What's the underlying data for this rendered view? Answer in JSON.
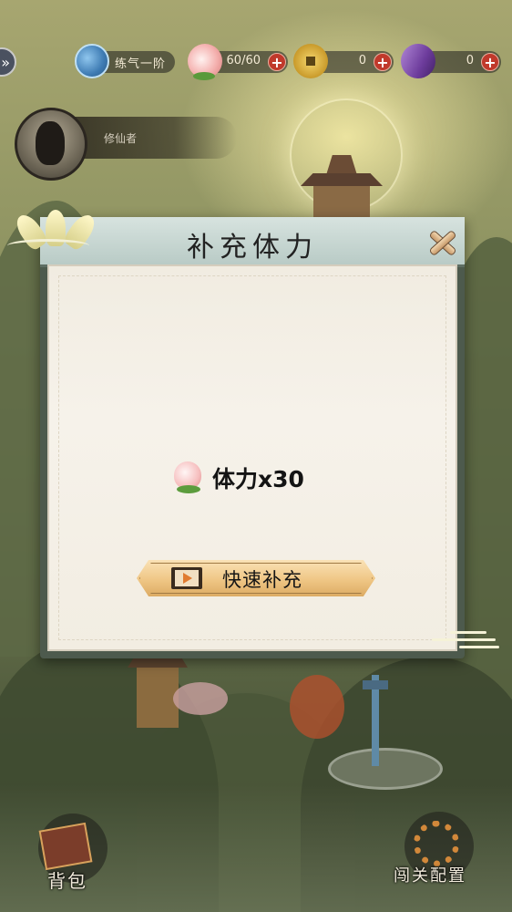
{
  "top_bar": {
    "realm": {
      "icon": "taiji-icon",
      "label": "练气一阶"
    },
    "stamina": {
      "icon": "peach-icon",
      "value": "60/60"
    },
    "copper": {
      "icon": "coin-icon",
      "value": "0"
    },
    "crystal": {
      "icon": "purple-gem-icon",
      "value": "0"
    }
  },
  "player": {
    "name": "修仙者"
  },
  "dialog": {
    "title": "补充体力",
    "reward_text": "体力x30",
    "refill_button": "快速补充"
  },
  "bottom": {
    "bag_label": "背包",
    "stage_config_label": "闯关配置"
  },
  "colors": {
    "plus_button": "#c0392b",
    "refill_button": "#efc685",
    "dialog_header": "#c9d8d4"
  }
}
